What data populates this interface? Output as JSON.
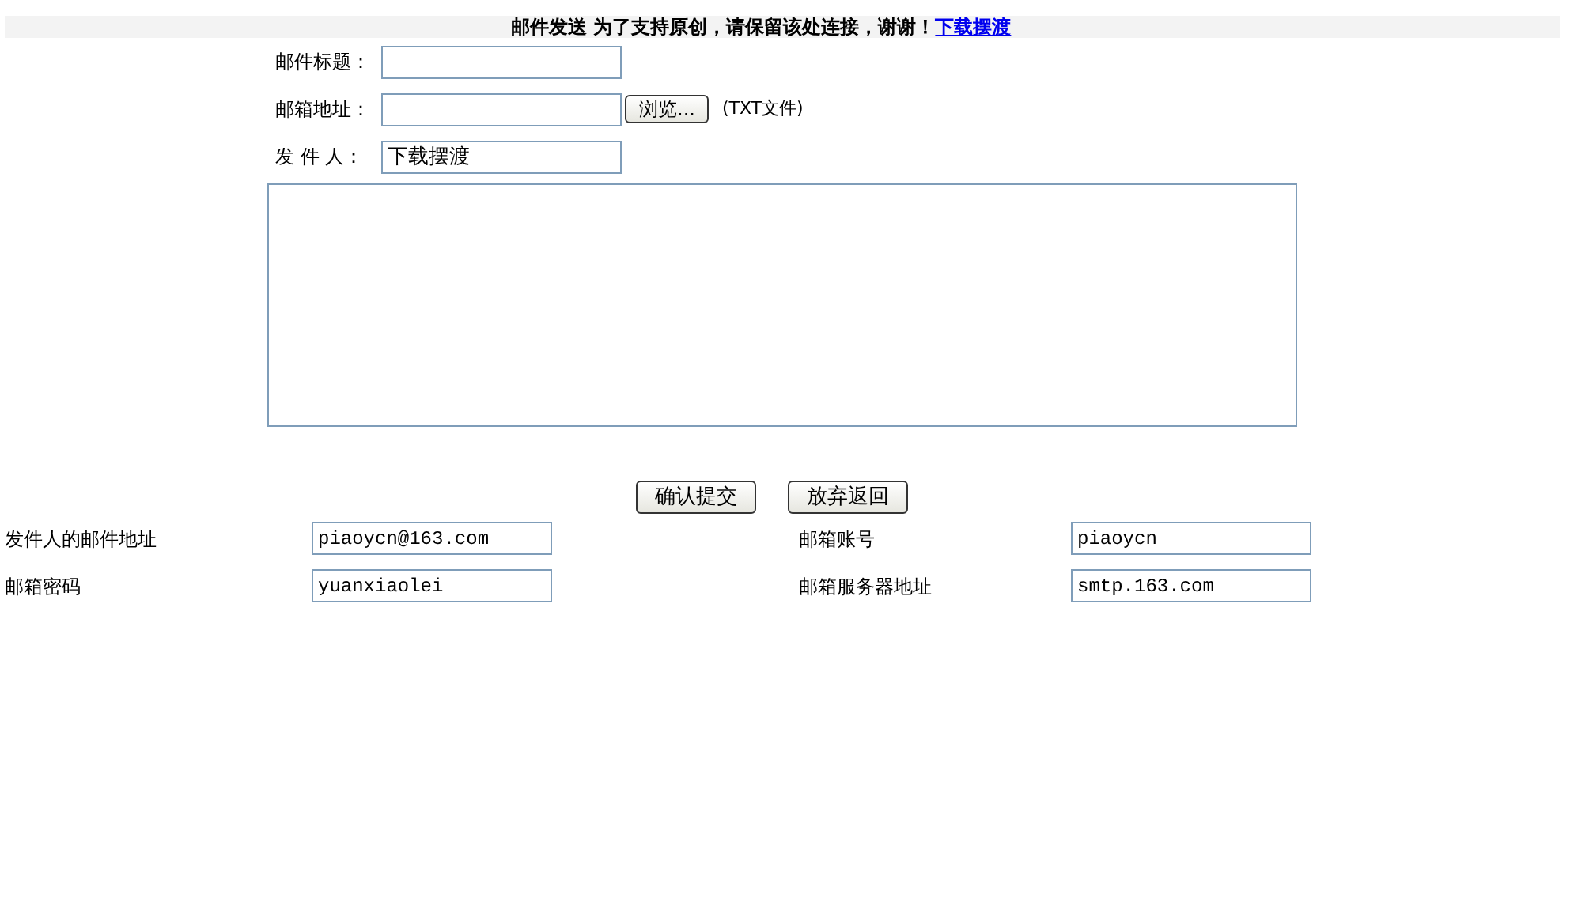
{
  "header": {
    "text": "邮件发送 为了支持原创，请保留该处连接，谢谢！",
    "link": "下载摆渡"
  },
  "fields": [
    {
      "label": "邮件标题："
    },
    {
      "label": "邮箱地址：",
      "button": "浏览...",
      "note": "(TXT文件)"
    },
    {
      "label": "发 件 人：",
      "value": "下载摆渡"
    }
  ],
  "buttons": [
    "确认提交",
    "放弃返回"
  ],
  "settings": [
    {
      "label": "发件人的邮件地址",
      "value": "piaoycn@163.com"
    },
    {
      "label": "邮箱账号",
      "value": "piaoycn"
    },
    {
      "label": "邮箱密码",
      "value": "yuanxiaolei"
    },
    {
      "label": "邮箱服务器地址",
      "value": "smtp.163.com"
    }
  ]
}
